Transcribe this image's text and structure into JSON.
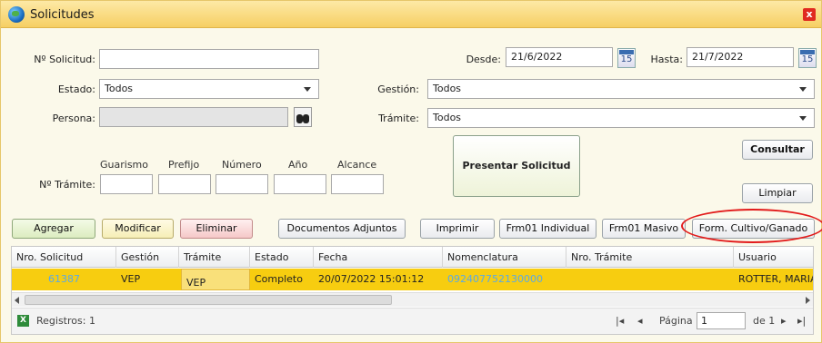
{
  "window": {
    "title": "Solicitudes",
    "close_label": "x"
  },
  "filters": {
    "nro_solicitud_label": "Nº Solicitud:",
    "nro_solicitud_value": "",
    "desde_label": "Desde:",
    "desde_value": "21/6/2022",
    "hasta_label": "Hasta:",
    "hasta_value": "21/7/2022",
    "calendar_day": "15",
    "estado_label": "Estado:",
    "estado_value": "Todos",
    "gestion_label": "Gestión:",
    "gestion_value": "Todos",
    "persona_label": "Persona:",
    "persona_value": "",
    "tramite_label": "Trámite:",
    "tramite_value": "Todos",
    "nro_tramite_label": "Nº Trámite:",
    "tramite_parts": [
      "Guarismo",
      "Prefijo",
      "Número",
      "Año",
      "Alcance"
    ]
  },
  "buttons": {
    "presentar": "Presentar Solicitud",
    "consultar": "Consultar",
    "limpiar": "Limpiar",
    "agregar": "Agregar",
    "modificar": "Modificar",
    "eliminar": "Eliminar",
    "documentos": "Documentos Adjuntos",
    "imprimir": "Imprimir",
    "frm01_individual": "Frm01 Individual",
    "frm01_masivo": "Frm01 Masivo",
    "form_cultivo": "Form. Cultivo/Ganado"
  },
  "table": {
    "columns": [
      "Nro. Solicitud",
      "Gestión",
      "Trámite",
      "Estado",
      "Fecha",
      "Nomenclatura",
      "Nro. Trámite",
      "Usuario"
    ],
    "rows": [
      [
        "61387",
        "VEP",
        "VEP",
        "Completo",
        "20/07/2022 15:01:12",
        "092407752130000",
        "",
        "ROTTER, MARIA"
      ]
    ]
  },
  "footer": {
    "registros": "Registros: 1",
    "pagina_label": "Página",
    "pagina_value": "1",
    "de_label": "de 1"
  },
  "colors": {
    "title_bar": "#f6cf63",
    "selected_row": "#f7cd10",
    "link_cell": "#5aa9e6",
    "highlight_circle": "#e21b1b"
  }
}
